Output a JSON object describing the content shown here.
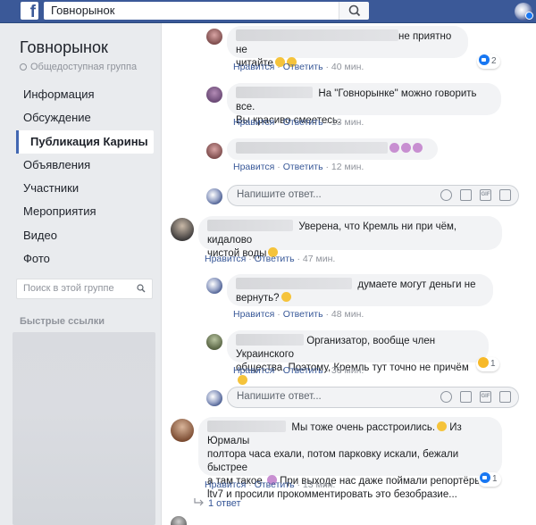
{
  "topbar": {
    "search_value": "Говнорынок"
  },
  "sidebar": {
    "group_name": "Говнорынок",
    "group_type": "Общедоступная группа",
    "nav": [
      {
        "label": "Информация"
      },
      {
        "label": "Обсуждение"
      },
      {
        "label": "Публикация Карины"
      },
      {
        "label": "Объявления"
      },
      {
        "label": "Участники"
      },
      {
        "label": "Мероприятия"
      },
      {
        "label": "Видео"
      },
      {
        "label": "Фото"
      }
    ],
    "search_placeholder": "Поиск в этой группе",
    "quick_links_title": "Быстрые ссылки"
  },
  "comments": [
    {
      "text": "не приятно не",
      "text2": "читайте",
      "actions": {
        "like": "Нравится",
        "reply": "Ответить",
        "time": "40 мин."
      },
      "reactions": "2"
    },
    {
      "text": "На \"Говнорынке\" можно говорить все.",
      "text2": "Вы красиво смеетесь.",
      "actions": {
        "like": "Нравится",
        "reply": "Ответить",
        "time": "13 мин."
      }
    },
    {
      "text": "",
      "actions": {
        "like": "Нравится",
        "reply": "Ответить",
        "time": "12 мин."
      }
    },
    {
      "text": "Уверена, что Кремль ни при чём, кидалово",
      "text2": "чистой воды",
      "actions": {
        "like": "Нравится",
        "reply": "Ответить",
        "time": "47 мин."
      }
    },
    {
      "text": "думаете могут деньги не",
      "text2": "вернуть?",
      "actions": {
        "like": "Нравится",
        "reply": "Ответить",
        "time": "48 мин."
      }
    },
    {
      "text": "Организатор, вообще член Украинского",
      "text2": "общества. Поэтому, Кремль тут точно не причём",
      "actions": {
        "like": "Нравится",
        "reply": "Ответить",
        "time": "30 мин."
      },
      "reactions": "1"
    },
    {
      "text": "Мы тоже очень расстроились.",
      "text_b": "Из Юрмалы",
      "text2": "полтора часа ехали, потом парковку искали, бежали быстрее",
      "text3": "а там такое.",
      "text3b": "При выходе нас даже поймали репортёры с",
      "text4": "ltv7 и просили прокомментировать это безобразие...",
      "actions": {
        "like": "Нравится",
        "reply": "Ответить",
        "time": "13 мин."
      },
      "reactions": "1"
    }
  ],
  "reply_box": {
    "placeholder": "Напишите ответ..."
  },
  "reply_count": "1 ответ",
  "colors": {
    "brand": "#3b5998",
    "link": "#385898",
    "bubble": "#f2f3f5"
  }
}
